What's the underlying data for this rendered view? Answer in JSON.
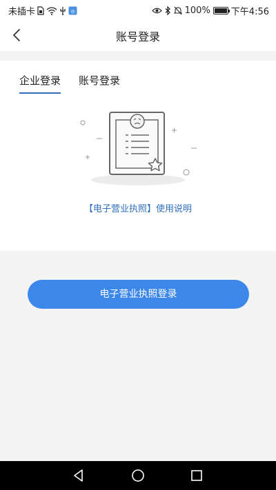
{
  "status_bar": {
    "carrier": "未插卡",
    "battery_percent": "100%",
    "battery_level": 1.0,
    "time": "下午4:56",
    "left_icons": [
      "sim-icon",
      "wifi-icon",
      "usb-icon",
      "app-notification-icon"
    ],
    "right_icons": [
      "eye-icon",
      "bluetooth-icon",
      "mute-icon",
      "battery-icon"
    ]
  },
  "navbar": {
    "title": "账号登录",
    "back_icon": "chevron-left-icon"
  },
  "tabs": [
    {
      "label": "企业登录",
      "active": true
    },
    {
      "label": "账号登录",
      "active": false
    }
  ],
  "illustration": {
    "icon": "business-license-icon"
  },
  "help_link": {
    "text": "【电子营业执照】使用说明"
  },
  "login_button": {
    "label": "电子营业执照登录"
  },
  "system_nav": {
    "icons": [
      "back-triangle-icon",
      "home-circle-icon",
      "recents-square-icon"
    ]
  },
  "colors": {
    "accent": "#3c87ea",
    "link": "#2f6fbd",
    "background": "#f4f4f4"
  }
}
